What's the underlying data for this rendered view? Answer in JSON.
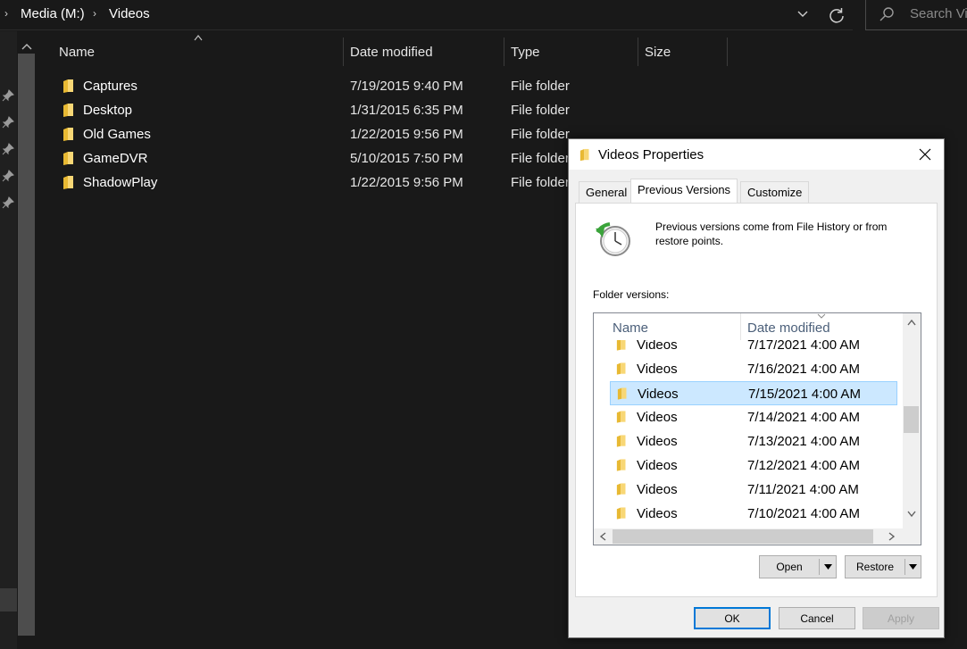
{
  "address_bar": {
    "crumbs": [
      "Media (M:)",
      "Videos"
    ],
    "search_placeholder": "Search Vi"
  },
  "icons": {
    "addr_dropdown": "chevron-down-icon",
    "refresh": "refresh-icon",
    "search": "search-icon",
    "pin": "pin-icon",
    "folder": "folder-icon"
  },
  "file_list": {
    "columns": [
      "Name",
      "Date modified",
      "Type",
      "Size"
    ],
    "rows": [
      {
        "name": "Captures",
        "date": "7/19/2015 9:40 PM",
        "type": "File folder"
      },
      {
        "name": "Desktop",
        "date": "1/31/2015 6:35 PM",
        "type": "File folder"
      },
      {
        "name": "Old Games",
        "date": "1/22/2015 9:56 PM",
        "type": "File folder"
      },
      {
        "name": "GameDVR",
        "date": "5/10/2015 7:50 PM",
        "type": "File folder"
      },
      {
        "name": "ShadowPlay",
        "date": "1/22/2015 9:56 PM",
        "type": "File folder"
      }
    ]
  },
  "dialog": {
    "title": "Videos Properties",
    "tabs": [
      "General",
      "Previous Versions",
      "Customize"
    ],
    "active_tab": "Previous Versions",
    "info_text": "Previous versions come from File History or from restore points.",
    "versions_label": "Folder versions:",
    "versions_columns": [
      "Name",
      "Date modified"
    ],
    "versions": [
      {
        "name": "Videos",
        "date": "7/17/2021 4:00 AM"
      },
      {
        "name": "Videos",
        "date": "7/16/2021 4:00 AM"
      },
      {
        "name": "Videos",
        "date": "7/15/2021 4:00 AM",
        "selected": true
      },
      {
        "name": "Videos",
        "date": "7/14/2021 4:00 AM"
      },
      {
        "name": "Videos",
        "date": "7/13/2021 4:00 AM"
      },
      {
        "name": "Videos",
        "date": "7/12/2021 4:00 AM"
      },
      {
        "name": "Videos",
        "date": "7/11/2021 4:00 AM"
      },
      {
        "name": "Videos",
        "date": "7/10/2021 4:00 AM"
      }
    ],
    "open_label": "Open",
    "restore_label": "Restore",
    "ok_label": "OK",
    "cancel_label": "Cancel",
    "apply_label": "Apply"
  },
  "colors": {
    "explorer_bg": "#191919",
    "selection": "#cce8ff",
    "default_button_border": "#0078d7"
  }
}
